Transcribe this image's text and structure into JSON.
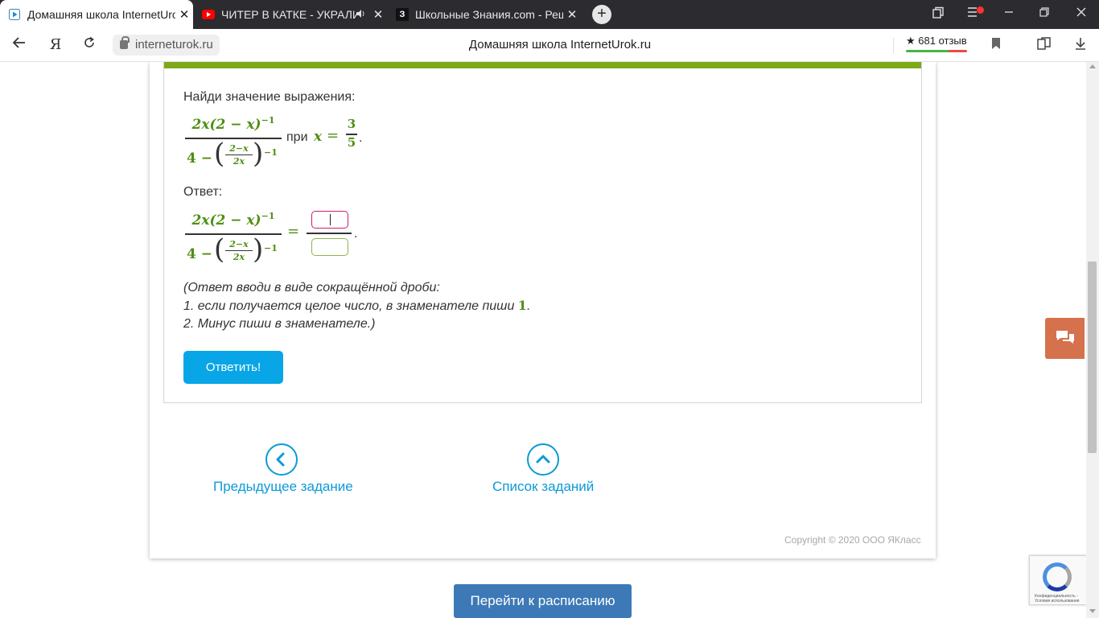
{
  "browser": {
    "tabs": [
      {
        "title": "Домашняя школа InternetUrok",
        "icon": "play-icon",
        "active": true
      },
      {
        "title": "ЧИТЕР В КАТКЕ - УКРАЛИ",
        "icon": "youtube-icon",
        "active": false
      },
      {
        "title": "Школьные Знания.com - Реш",
        "icon": "znanija-icon",
        "active": false
      }
    ],
    "url": "interneturok.ru",
    "page_title": "Домашняя школа InternetUrok.ru",
    "reviews": "★ 681 отзыв",
    "znanija_letter": "З"
  },
  "task": {
    "prompt": "Найди значение выражения:",
    "at_word": "при",
    "answer_label": "Ответ:",
    "hint_lines": [
      "(Ответ вводи в виде сокращённой дроби:",
      "1. если получается целое число, в знаменателе пиши",
      "2. Минус пиши в знаменателе.)"
    ],
    "hint_number": "1",
    "submit_label": "Ответить!"
  },
  "formula": {
    "num_main": "2x(2 − x)",
    "num_exp": "−1",
    "den_lead": "4 −",
    "inner_num": "2−x",
    "inner_den": "2x",
    "den_exp": "−1",
    "var": "x",
    "equals": "=",
    "value_num": "3",
    "value_den": "5",
    "period": "."
  },
  "navigation": {
    "prev_label": "Предыдущее задание",
    "list_label": "Список заданий"
  },
  "footer": {
    "copyright": "Copyright © 2020 ООО ЯКласс",
    "schedule_button": "Перейти к расписанию",
    "recaptcha_text": "Конфиденциальность - Условия использования"
  }
}
